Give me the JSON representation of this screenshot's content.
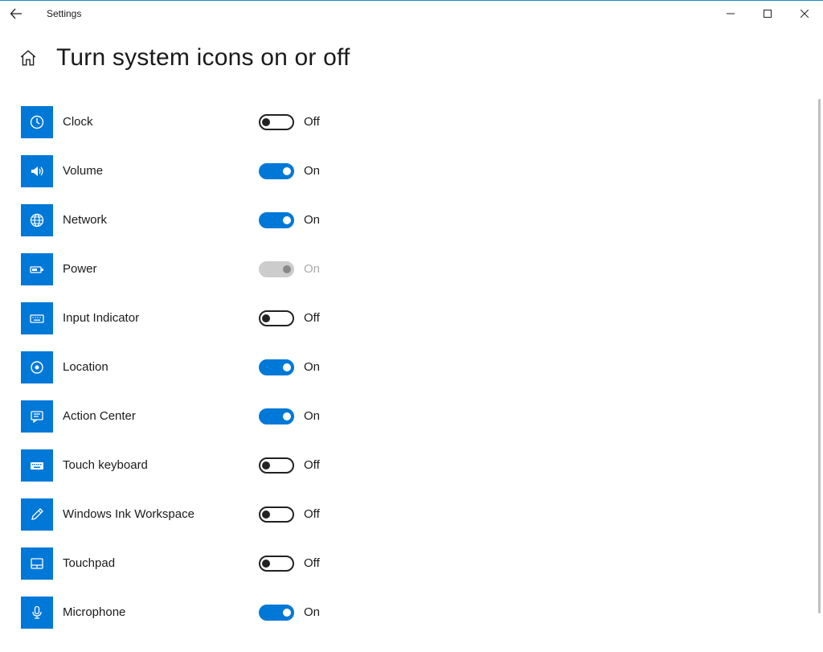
{
  "window": {
    "app_title": "Settings"
  },
  "page": {
    "title": "Turn system icons on or off"
  },
  "labels": {
    "on": "On",
    "off": "Off"
  },
  "items": [
    {
      "id": "clock",
      "label": "Clock",
      "icon": "clock",
      "state": "off",
      "state_label": "Off"
    },
    {
      "id": "volume",
      "label": "Volume",
      "icon": "volume",
      "state": "on",
      "state_label": "On"
    },
    {
      "id": "network",
      "label": "Network",
      "icon": "network",
      "state": "on",
      "state_label": "On"
    },
    {
      "id": "power",
      "label": "Power",
      "icon": "power",
      "state": "disabled",
      "state_label": "On"
    },
    {
      "id": "input",
      "label": "Input Indicator",
      "icon": "keyboard",
      "state": "off",
      "state_label": "Off"
    },
    {
      "id": "location",
      "label": "Location",
      "icon": "location",
      "state": "on",
      "state_label": "On"
    },
    {
      "id": "action",
      "label": "Action Center",
      "icon": "action",
      "state": "on",
      "state_label": "On"
    },
    {
      "id": "touchkb",
      "label": "Touch keyboard",
      "icon": "touchkb",
      "state": "off",
      "state_label": "Off"
    },
    {
      "id": "ink",
      "label": "Windows Ink Workspace",
      "icon": "ink",
      "state": "off",
      "state_label": "Off"
    },
    {
      "id": "touchpad",
      "label": "Touchpad",
      "icon": "touchpad",
      "state": "off",
      "state_label": "Off"
    },
    {
      "id": "mic",
      "label": "Microphone",
      "icon": "microphone",
      "state": "on",
      "state_label": "On"
    }
  ]
}
